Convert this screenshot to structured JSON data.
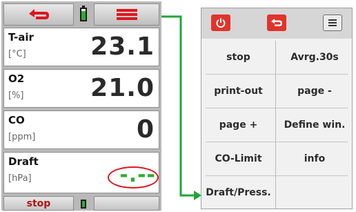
{
  "device": {
    "top_bar": {
      "back_icon": "undo-arrow-icon",
      "battery_icon": "battery-icon",
      "menu_icon": "hamburger-menu-icon",
      "accent_color": "#e0151e"
    },
    "readings": [
      {
        "name": "T-air",
        "unit": "[°C]",
        "value": "23.1"
      },
      {
        "name": "O2",
        "unit": "[%]",
        "value": "21.0"
      },
      {
        "name": "CO",
        "unit": "[ppm]",
        "value": "0"
      },
      {
        "name": "Draft",
        "unit": "[hPa]",
        "value": "-.--"
      }
    ],
    "bottom_bar": {
      "stop_label": "stop",
      "battery_icon": "battery-icon",
      "right_label": ""
    },
    "highlight_color": "#e0151e",
    "value_dash_color": "#2fae2f"
  },
  "connector": {
    "color": "#1fa53a"
  },
  "menu": {
    "top_icons": {
      "power": "power-icon",
      "back": "undo-arrow-icon",
      "list": "list-menu-icon"
    },
    "items": [
      [
        "stop",
        "Avrg.30s"
      ],
      [
        "print-out",
        "page -"
      ],
      [
        "page +",
        "Define win."
      ],
      [
        "CO-Limit",
        "info"
      ],
      [
        "Draft/Press.",
        ""
      ]
    ]
  }
}
